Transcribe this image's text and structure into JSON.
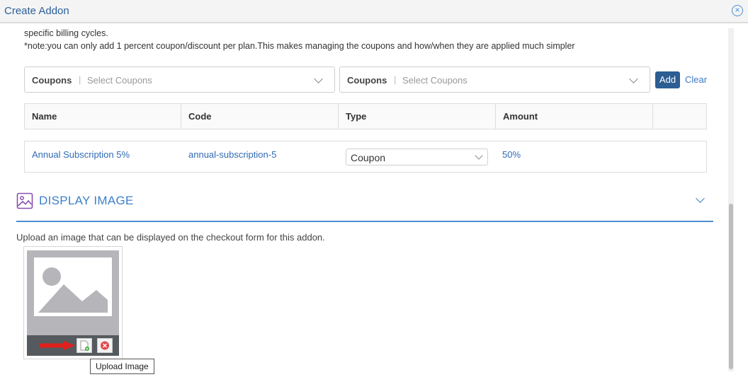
{
  "window": {
    "title": "Create Addon"
  },
  "notes": {
    "line1": "specific billing cycles.",
    "line2": "*note:you can only add 1 percent coupon/discount per plan.This makes managing the coupons and how/when they are applied much simpler"
  },
  "coupon_selects": [
    {
      "label": "Coupons",
      "separator": "|",
      "placeholder": "Select Coupons"
    },
    {
      "label": "Coupons",
      "separator": "|",
      "placeholder": "Select Coupons"
    }
  ],
  "buttons": {
    "add": "Add",
    "clear": "Clear"
  },
  "table": {
    "headers": [
      "Name",
      "Code",
      "Type",
      "Amount",
      ""
    ],
    "rows": [
      {
        "name": "Annual Subscription 5%",
        "code": "annual-subscription-5",
        "type": "Coupon",
        "amount": "50%"
      }
    ]
  },
  "display_image": {
    "title": "DISPLAY IMAGE",
    "description": "Upload an image that can be displayed on the checkout form for this addon.",
    "tooltip": "Upload Image"
  },
  "colors": {
    "accent": "#3d7fc7",
    "button_primary": "#2c5d93",
    "link": "#2f6bb5",
    "arrow": "#e0201c"
  },
  "icons": [
    "close-circle-icon",
    "chevron-down-icon",
    "image-icon",
    "upload-file-icon",
    "remove-icon",
    "red-arrow-icon"
  ]
}
